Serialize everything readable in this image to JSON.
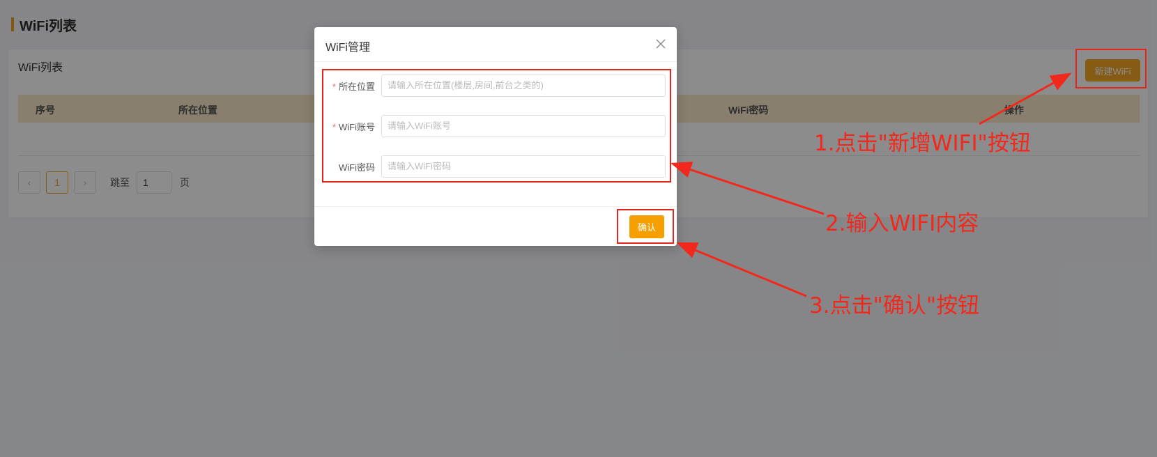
{
  "page": {
    "title": "WiFi列表"
  },
  "card": {
    "title": "WiFi列表",
    "new_button": "新建WiFi",
    "columns": [
      "序号",
      "所在位置",
      "WiFi密码",
      "操作"
    ]
  },
  "pagination": {
    "prev": "‹",
    "current": "1",
    "next": "›",
    "jump_label": "跳至",
    "jump_value": "1",
    "page_suffix": "页"
  },
  "modal": {
    "title": "WiFi管理",
    "fields": [
      {
        "required": "*",
        "label": "所在位置",
        "placeholder": "请输入所在位置(楼层,房间,前台之类的)"
      },
      {
        "required": "*",
        "label": "WiFi账号",
        "placeholder": "请输入WiFi账号"
      },
      {
        "required": "",
        "label": "WiFi密码",
        "placeholder": "请输入WiFi密码"
      }
    ],
    "confirm_button": "确认"
  },
  "annotations": {
    "step1": "1.点击\"新增WIFI\"按钮",
    "step2": "2.输入WIFI内容",
    "step3": "3.点击\"确认\"按钮"
  },
  "colors": {
    "accent": "#f5a623",
    "annotation": "#f2281c",
    "table_header_bg": "#f7e7c8"
  }
}
